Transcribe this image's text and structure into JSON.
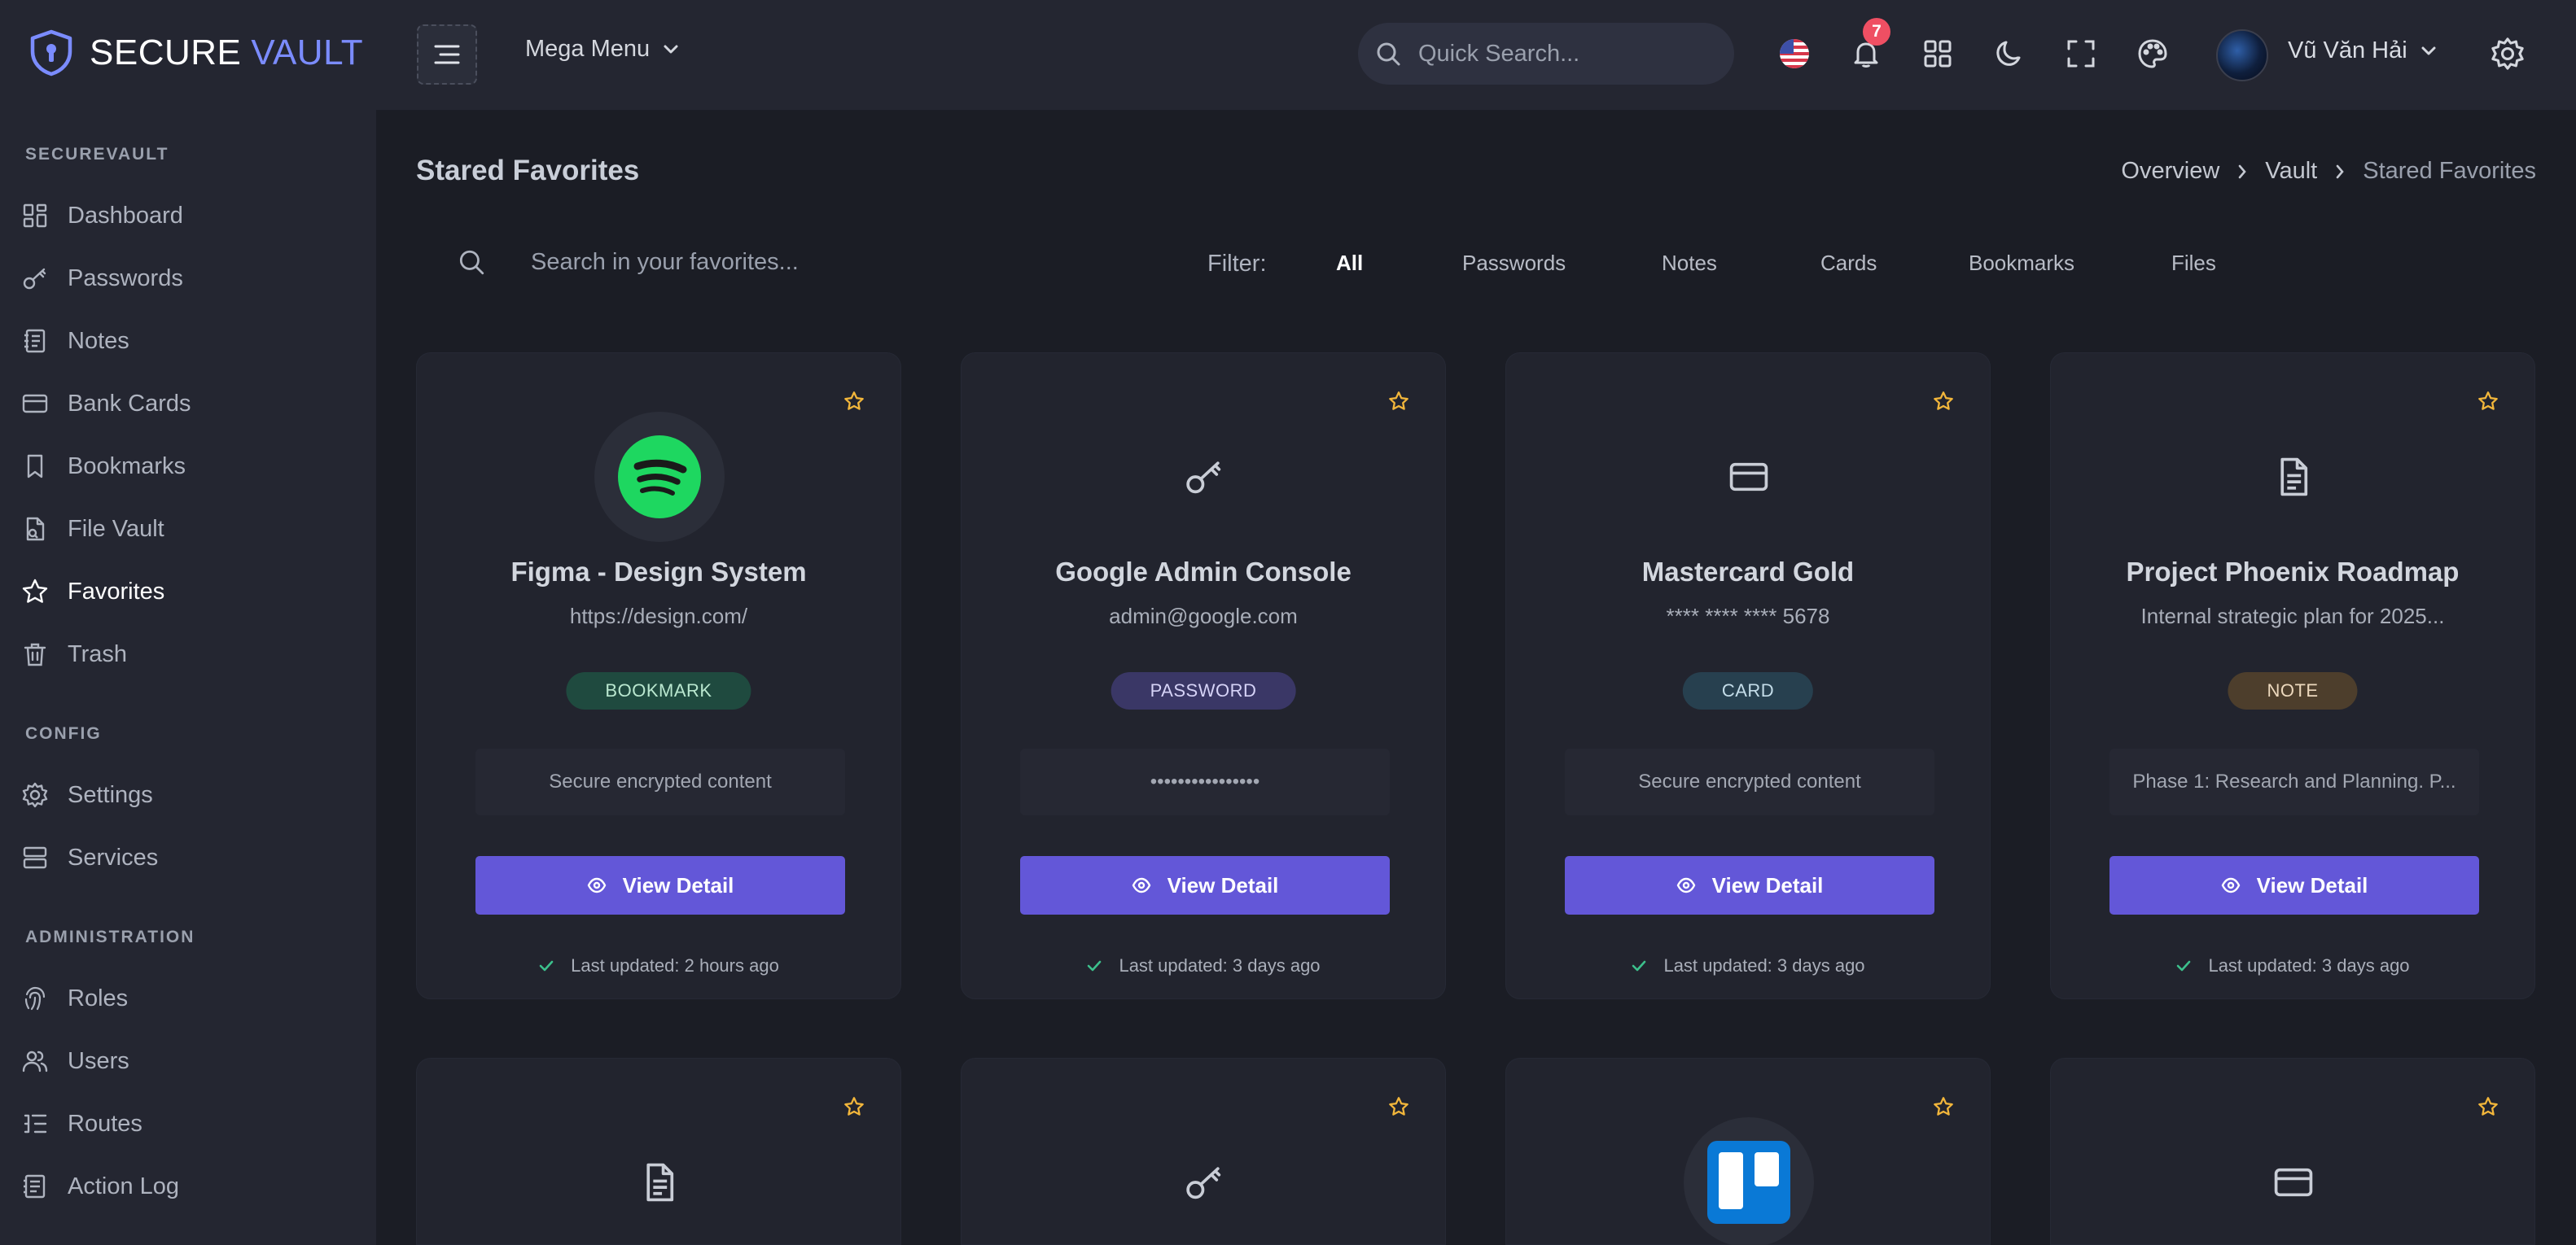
{
  "brand": {
    "name_a": "SECURE",
    "name_b": "VAULT"
  },
  "sidebar": {
    "sections": [
      "SECUREVAULT",
      "CONFIG",
      "ADMINISTRATION"
    ],
    "items": [
      {
        "label": "Dashboard",
        "icon": "dashboard-icon"
      },
      {
        "label": "Passwords",
        "icon": "key-icon"
      },
      {
        "label": "Notes",
        "icon": "notebook-icon"
      },
      {
        "label": "Bank Cards",
        "icon": "card-icon"
      },
      {
        "label": "Bookmarks",
        "icon": "bookmark-icon"
      },
      {
        "label": "File Vault",
        "icon": "file-lock-icon"
      },
      {
        "label": "Favorites",
        "icon": "star-icon",
        "active": true
      },
      {
        "label": "Trash",
        "icon": "trash-icon"
      },
      {
        "label": "Settings",
        "icon": "gear-icon"
      },
      {
        "label": "Services",
        "icon": "server-icon"
      },
      {
        "label": "Roles",
        "icon": "fingerprint-icon"
      },
      {
        "label": "Users",
        "icon": "users-icon"
      },
      {
        "label": "Routes",
        "icon": "list-icon"
      },
      {
        "label": "Action Log",
        "icon": "log-icon"
      }
    ]
  },
  "topbar": {
    "mega_menu": "Mega Menu",
    "search_placeholder": "Quick Search...",
    "notification_count": "7",
    "user_name": "Vũ Văn Hải"
  },
  "page": {
    "title": "Stared Favorites",
    "breadcrumb": [
      "Overview",
      "Vault",
      "Stared Favorites"
    ]
  },
  "filter": {
    "search_placeholder": "Search in your favorites...",
    "label": "Filter:",
    "options": [
      "All",
      "Passwords",
      "Notes",
      "Cards",
      "Bookmarks",
      "Files"
    ],
    "active": "All"
  },
  "cards": [
    {
      "title": "Figma - Design System",
      "subtitle": "https://design.com/",
      "type": "BOOKMARK",
      "content": "Secure encrypted content",
      "button": "View Detail",
      "updated": "Last updated: 2 hours ago",
      "icon": "spotify-icon"
    },
    {
      "title": "Google Admin Console",
      "subtitle": "admin@google.com",
      "type": "PASSWORD",
      "content": "••••••••••••••••",
      "button": "View Detail",
      "updated": "Last updated: 3 days ago",
      "icon": "key-icon"
    },
    {
      "title": "Mastercard Gold",
      "subtitle": "**** **** **** 5678",
      "type": "CARD",
      "content": "Secure encrypted content",
      "button": "View Detail",
      "updated": "Last updated: 3 days ago",
      "icon": "card-icon"
    },
    {
      "title": "Project Phoenix Roadmap",
      "subtitle": "Internal strategic plan for 2025...",
      "type": "NOTE",
      "content": "Phase 1: Research and Planning. P...",
      "button": "View Detail",
      "updated": "Last updated: 3 days ago",
      "icon": "document-icon"
    }
  ],
  "colors": {
    "accent": "#6357d8",
    "bookmark_bg": "#1f4a3f",
    "bookmark_fg": "#b9e7cf",
    "password_bg": "#3a3766",
    "password_fg": "#d6d3f7",
    "card_bg": "#27404f",
    "card_fg": "#c4dde9",
    "note_bg": "#4d3e2c",
    "note_fg": "#ecd8bd",
    "star": "#f2b63b",
    "check": "#3cc08c"
  }
}
